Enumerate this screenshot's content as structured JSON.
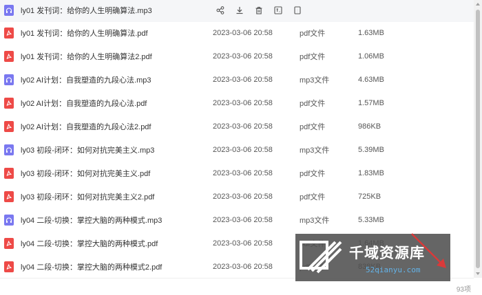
{
  "files": [
    {
      "name": "ly01 发刊词：给你的人生明确算法.mp3",
      "date": "",
      "kind": "",
      "size": "",
      "type": "mp3",
      "hover": true
    },
    {
      "name": "ly01 发刊词：给你的人生明确算法.pdf",
      "date": "2023-03-06 20:58",
      "kind": "pdf文件",
      "size": "1.63MB",
      "type": "pdf"
    },
    {
      "name": "ly01 发刊词：给你的人生明确算法2.pdf",
      "date": "2023-03-06 20:58",
      "kind": "pdf文件",
      "size": "1.06MB",
      "type": "pdf"
    },
    {
      "name": "ly02 AI计划：自我塑造的九段心法.mp3",
      "date": "2023-03-06 20:58",
      "kind": "mp3文件",
      "size": "4.63MB",
      "type": "mp3"
    },
    {
      "name": "ly02 AI计划：自我塑造的九段心法.pdf",
      "date": "2023-03-06 20:58",
      "kind": "pdf文件",
      "size": "1.57MB",
      "type": "pdf"
    },
    {
      "name": "ly02 AI计划：自我塑造的九段心法2.pdf",
      "date": "2023-03-06 20:58",
      "kind": "pdf文件",
      "size": "986KB",
      "type": "pdf"
    },
    {
      "name": "ly03 初段-闭环：如何对抗完美主义.mp3",
      "date": "2023-03-06 20:58",
      "kind": "mp3文件",
      "size": "5.39MB",
      "type": "mp3"
    },
    {
      "name": "ly03 初段-闭环：如何对抗完美主义.pdf",
      "date": "2023-03-06 20:58",
      "kind": "pdf文件",
      "size": "1.83MB",
      "type": "pdf"
    },
    {
      "name": "ly03 初段-闭环：如何对抗完美主义2.pdf",
      "date": "2023-03-06 20:58",
      "kind": "pdf文件",
      "size": "725KB",
      "type": "pdf"
    },
    {
      "name": "ly04 二段-切换：掌控大脑的两种模式.mp3",
      "date": "2023-03-06 20:58",
      "kind": "mp3文件",
      "size": "5.33MB",
      "type": "mp3"
    },
    {
      "name": "ly04 二段-切换：掌控大脑的两种模式.pdf",
      "date": "2023-03-06 20:58",
      "kind": "pdf文件",
      "size": "1.64MB",
      "type": "pdf"
    },
    {
      "name": "ly04 二段-切换：掌控大脑的两种模式2.pdf",
      "date": "2023-03-06 20:58",
      "kind": "pdf文件",
      "size": "838KB",
      "type": "pdf"
    }
  ],
  "hover_actions": [
    "share-icon",
    "download-icon",
    "delete-icon",
    "rename-icon",
    "more-icon"
  ],
  "icons": {
    "pdf": "pdf-file-icon",
    "mp3": "audio-file-icon"
  },
  "colors": {
    "pdf_icon": "#ee4a47",
    "mp3_icon": "#7a78f0",
    "hover_row": "#f5f6f8",
    "watermark_url": "#63b3e8"
  },
  "footer": {
    "count": "93项"
  },
  "watermark": {
    "title": "千域资源库",
    "url": "52qianyu.com"
  }
}
